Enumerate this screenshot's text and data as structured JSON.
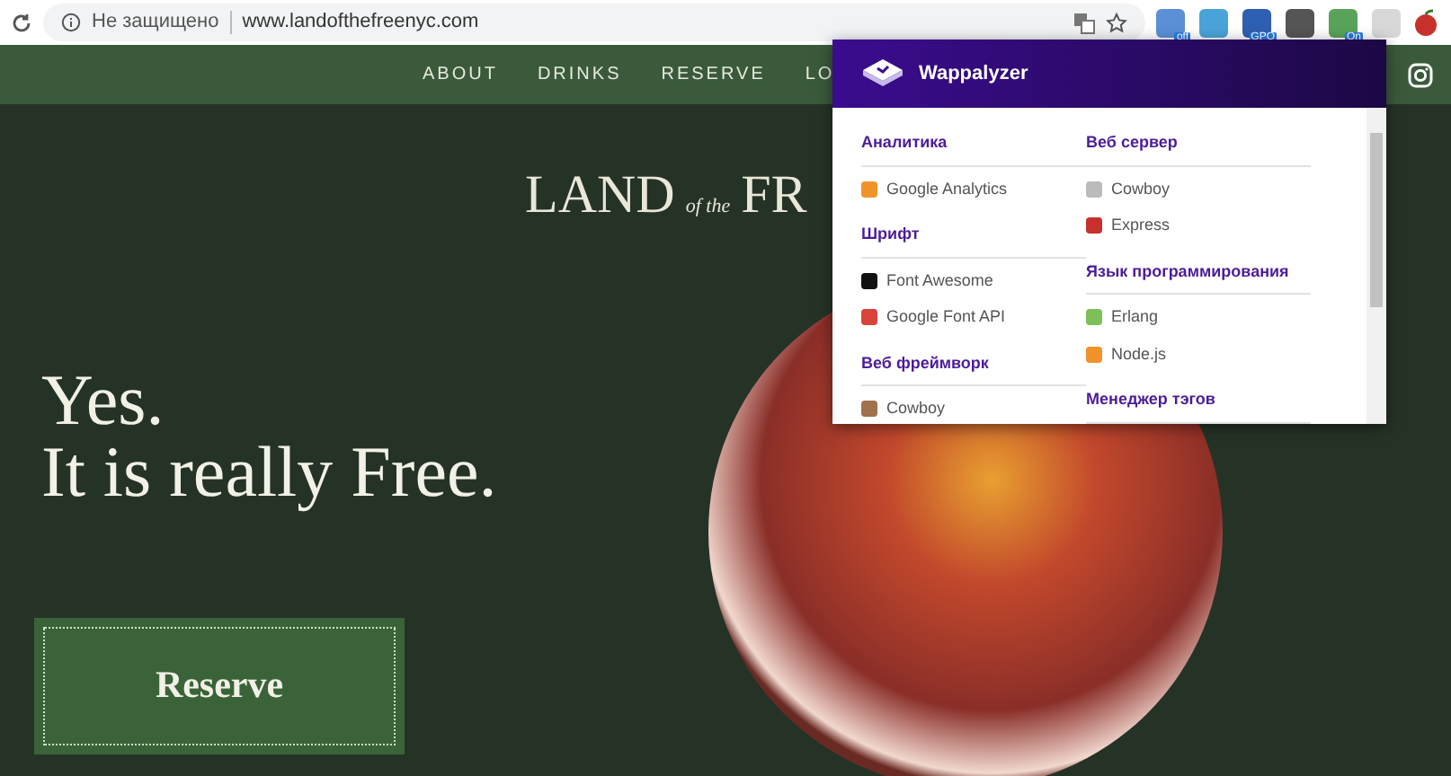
{
  "browser": {
    "security_label": "Не защищено",
    "url": "www.landofthefreenyc.com",
    "extensions": [
      {
        "kind": "badged",
        "badge": "off"
      },
      {
        "kind": "plain"
      },
      {
        "kind": "badged",
        "badge": "GPO"
      },
      {
        "kind": "plain"
      },
      {
        "kind": "badged",
        "badge": "On"
      },
      {
        "kind": "plain"
      }
    ]
  },
  "site": {
    "nav": [
      "ABOUT",
      "DRINKS",
      "RESERVE",
      "LO"
    ],
    "logo": {
      "first_word": "LAND",
      "middle": "of the",
      "last_word": "FR"
    },
    "headline": [
      "Yes.",
      "It is really Free."
    ],
    "reserve_button": "Reserve"
  },
  "popup": {
    "title": "Wappalyzer",
    "columns": [
      [
        {
          "category": "Аналитика",
          "apps": [
            "Google Analytics"
          ]
        },
        {
          "category": "Шрифт",
          "apps": [
            "Font Awesome",
            "Google Font API"
          ]
        },
        {
          "category": "Веб фреймворк",
          "apps": [
            "Cowboy"
          ]
        }
      ],
      [
        {
          "category": "Веб сервер",
          "apps": [
            "Cowboy",
            "Express"
          ]
        },
        {
          "category": "Язык программирования",
          "apps": [
            "Erlang",
            "Node.js"
          ]
        },
        {
          "category": "Менеджер тэгов"
        }
      ]
    ]
  }
}
